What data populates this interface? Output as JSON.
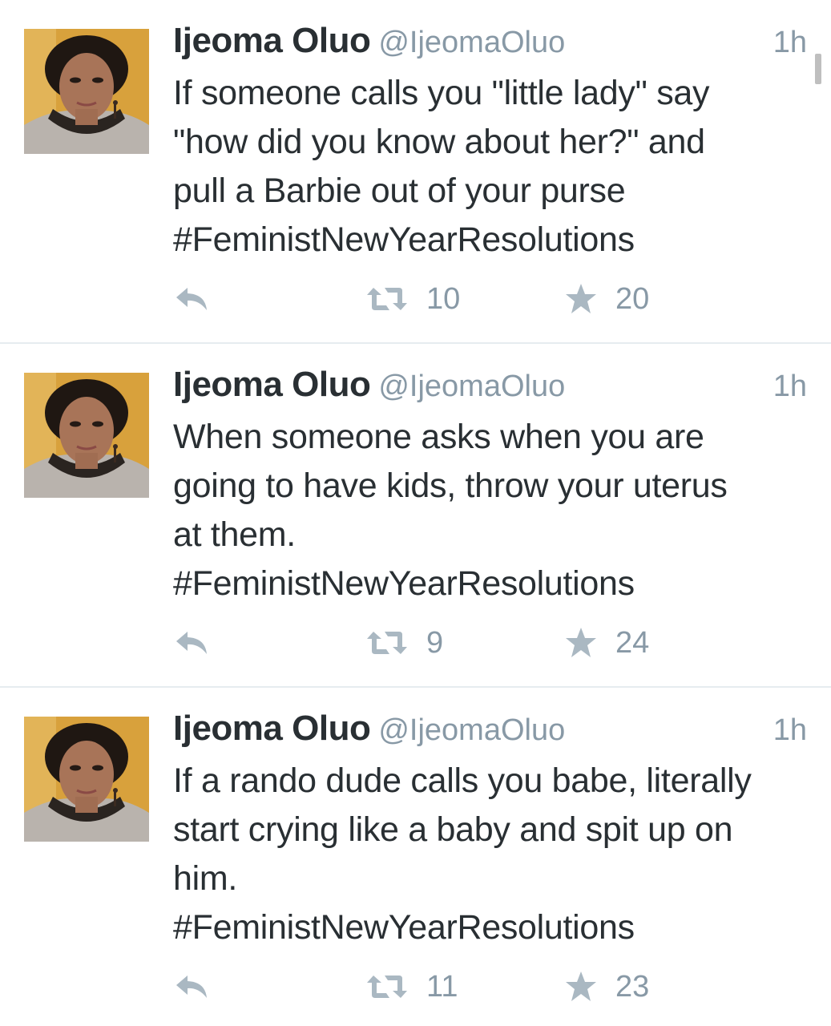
{
  "tweets": [
    {
      "author_name": "Ijeoma Oluo",
      "author_handle": "@IjeomaOluo",
      "time": "1h",
      "text": "If someone calls you \"little lady\" say\n\"how did you know about her?\" and\npull a Barbie out of your purse\n#FeministNewYearResolutions",
      "retweets": "10",
      "favorites": "20"
    },
    {
      "author_name": "Ijeoma Oluo",
      "author_handle": "@IjeomaOluo",
      "time": "1h",
      "text": "When someone asks when you are\ngoing to have kids, throw your uterus\nat them.\n#FeministNewYearResolutions",
      "retweets": "9",
      "favorites": "24"
    },
    {
      "author_name": "Ijeoma Oluo",
      "author_handle": "@IjeomaOluo",
      "time": "1h",
      "text": "If a rando dude calls you babe, literally\nstart crying like a baby and spit up on\nhim.\n#FeministNewYearResolutions",
      "retweets": "11",
      "favorites": "23"
    }
  ],
  "icons": {
    "reply": "reply-icon",
    "retweet": "retweet-icon",
    "favorite": "star-icon",
    "avatar": "avatar"
  },
  "colors": {
    "text": "#292f33",
    "muted": "#8899a6",
    "icon": "#aab8c2",
    "divider": "#e6ecf0"
  }
}
